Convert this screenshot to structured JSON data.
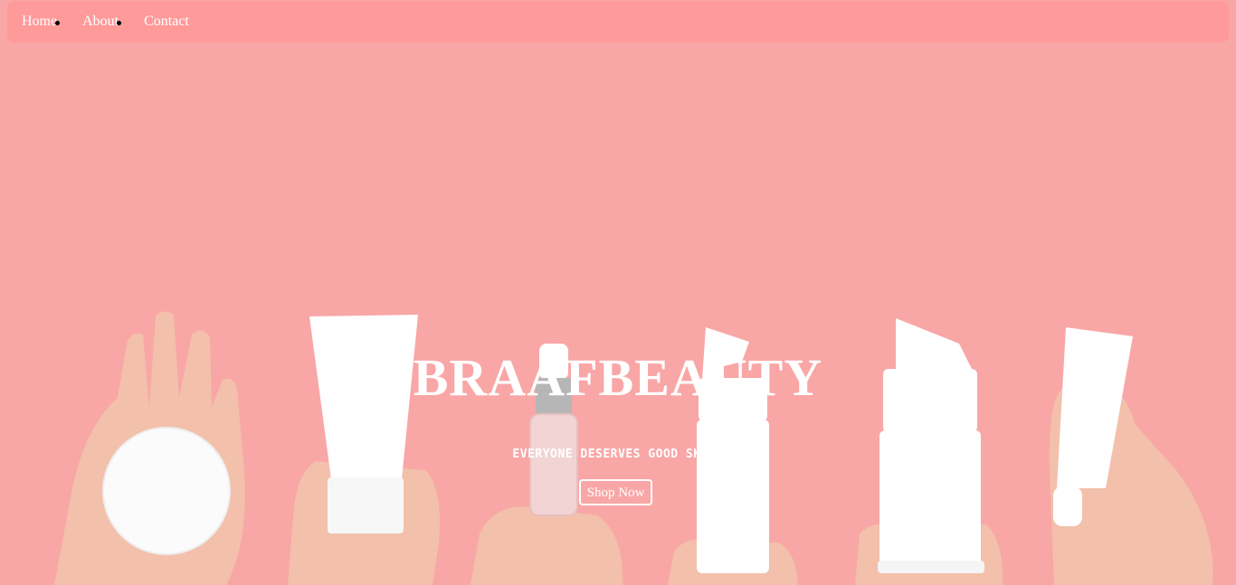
{
  "nav": {
    "items": [
      {
        "label": "Home"
      },
      {
        "label": "About"
      },
      {
        "label": "Contact"
      }
    ]
  },
  "hero": {
    "brand": "BRAAFBEAUTY",
    "tagline": "EVERYONE DESERVES GOOD SKIN!",
    "cta_label": "Shop Now"
  },
  "colors": {
    "background": "#f9a6a6",
    "navbar": "#ff9a9a",
    "text": "#ffffff",
    "skin": "#f3c2ad",
    "product": "#ffffff"
  }
}
